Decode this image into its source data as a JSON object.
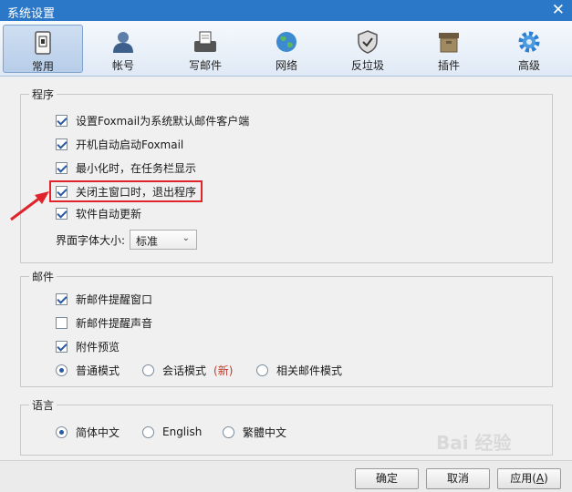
{
  "window": {
    "title": "系统设置",
    "close_glyph": "✕"
  },
  "tabs": [
    {
      "label": "常用",
      "icon": "phone-icon",
      "active": true
    },
    {
      "label": "帐号",
      "icon": "user-icon"
    },
    {
      "label": "写邮件",
      "icon": "compose-icon"
    },
    {
      "label": "网络",
      "icon": "globe-icon"
    },
    {
      "label": "反垃圾",
      "icon": "shield-icon"
    },
    {
      "label": "插件",
      "icon": "box-icon"
    },
    {
      "label": "高级",
      "icon": "gear-icon"
    }
  ],
  "program": {
    "title": "程序",
    "options": [
      {
        "label": "设置Foxmail为系统默认邮件客户端",
        "checked": true
      },
      {
        "label": "开机自动启动Foxmail",
        "checked": true
      },
      {
        "label": "最小化时，在任务栏显示",
        "checked": true
      },
      {
        "label": "关闭主窗口时，退出程序",
        "checked": true
      },
      {
        "label": "软件自动更新",
        "checked": true
      }
    ],
    "font_size_label": "界面字体大小:",
    "font_size_value": "标准",
    "caret_glyph": "⌄"
  },
  "mail": {
    "title": "邮件",
    "options": [
      {
        "label": "新邮件提醒窗口",
        "checked": true
      },
      {
        "label": "新邮件提醒声音",
        "checked": false
      },
      {
        "label": "附件预览",
        "checked": true
      }
    ],
    "modes": [
      {
        "label": "普通模式",
        "selected": true
      },
      {
        "label": "会话模式",
        "badge": "(新)",
        "selected": false
      },
      {
        "label": "相关邮件模式",
        "selected": false
      }
    ]
  },
  "language": {
    "title": "语言",
    "options": [
      {
        "label": "简体中文",
        "selected": true
      },
      {
        "label": "English",
        "selected": false
      },
      {
        "label": "繁體中文",
        "selected": false
      }
    ]
  },
  "buttons": {
    "ok": "确定",
    "cancel": "取消",
    "apply_prefix": "应用(",
    "apply_key": "A",
    "apply_suffix": ")"
  },
  "watermark": "Bai 经验",
  "colors": {
    "titlebar": "#2b78c9",
    "highlight": "#e0242b",
    "new_badge": "#c0392b"
  }
}
